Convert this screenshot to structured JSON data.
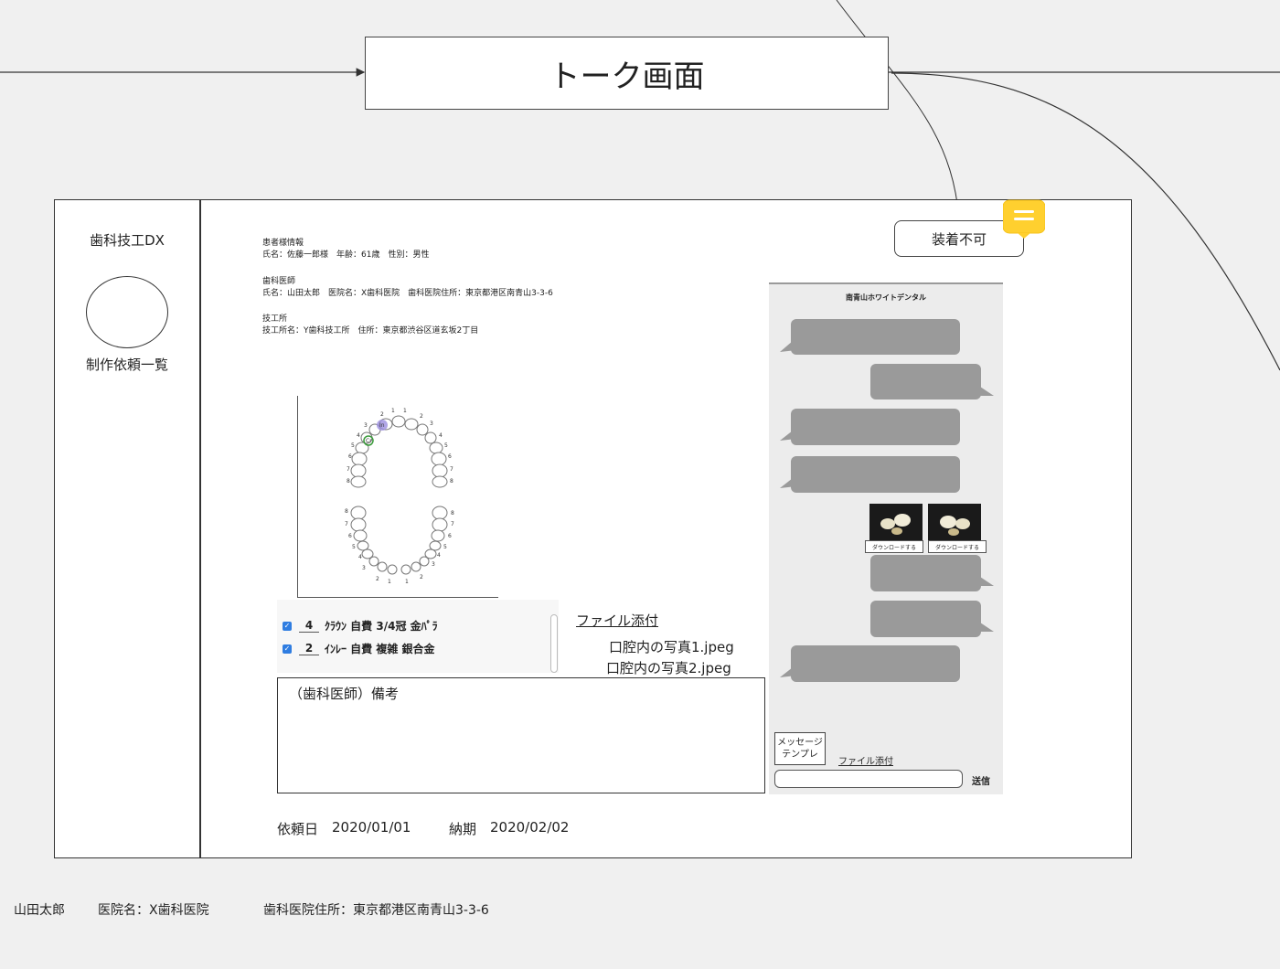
{
  "flow": {
    "screen_title": "トーク画面"
  },
  "sidebar": {
    "app_name": "歯科技工DX",
    "nav_item": "制作依頼一覧"
  },
  "patient_info": {
    "heading": "患者様情報",
    "details": "氏名：佐藤一郎様　年齢：61歳　性別：男性"
  },
  "dentist_info": {
    "heading": "歯科医師",
    "details": "氏名：山田太郎　医院名：X歯科医院　歯科医院住所：東京都港区南青山3-3-6"
  },
  "lab_info": {
    "heading": "技工所",
    "details": "技工所名：Y歯科技工所　住所：東京都渋谷区道玄坂2丁目"
  },
  "tooth_chart": {
    "upper_numbers": [
      "1",
      "1",
      "2",
      "2",
      "3",
      "4",
      "5",
      "6",
      "7",
      "8",
      "3",
      "4",
      "5",
      "6",
      "7",
      "8"
    ],
    "markers": [
      "In",
      "Cr"
    ]
  },
  "prosthesis_list": [
    {
      "checked": true,
      "tooth": "4",
      "description": "ｸﾗｳﾝ 自費 3/4冠 金ﾊﾟﾗ"
    },
    {
      "checked": true,
      "tooth": "2",
      "description": "ｲﾝﾚｰ 自費 複雑 銀合金"
    }
  ],
  "attachments": {
    "link_label": "ファイル添付",
    "files": [
      "口腔内の写真1.jpeg",
      "口腔内の写真2.jpeg"
    ]
  },
  "memo": {
    "label": "（歯科医師）備考"
  },
  "dates": {
    "request_label": "依頼日",
    "request_date": "2020/01/01",
    "due_label": "納期",
    "due_date": "2020/02/02"
  },
  "status_button": {
    "label": "装着不可"
  },
  "chat": {
    "header": "南青山ホワイトデンタル",
    "download_label": "ダウンロードする",
    "template_button": "メッセージ\nテンプレ",
    "file_attach": "ファイル添付",
    "send": "送信"
  },
  "bottom_note": {
    "name": "山田太郎",
    "clinic": "医院名：X歯科医院",
    "address": "歯科医院住所：東京都港区南青山3-3-6"
  },
  "colors": {
    "bubble": "#9a9a9a",
    "accent_note": "#ffd02f",
    "checkbox": "#2f7de1"
  }
}
